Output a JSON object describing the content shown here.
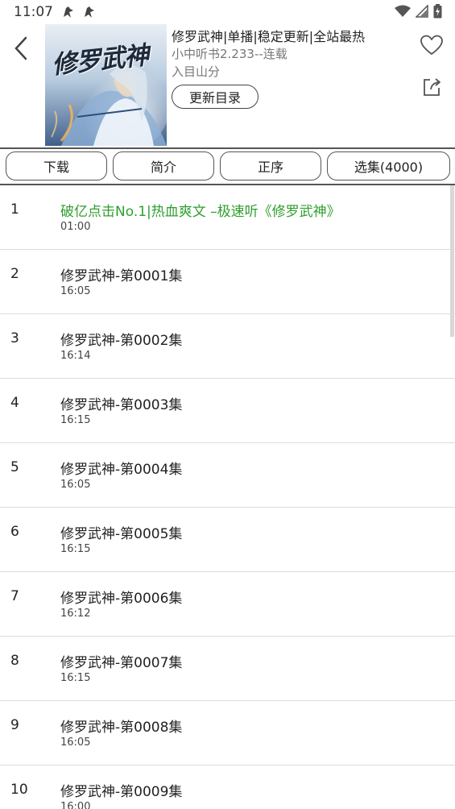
{
  "status_bar": {
    "time": "11:07"
  },
  "header": {
    "title": "修罗武神|单播|稳定更新|全站最热",
    "subtitle": "小中听书2.233--连载",
    "author": "入目山分",
    "update_button": "更新目录",
    "cover_art_text": "修罗武神"
  },
  "tabs": [
    {
      "label": "下载"
    },
    {
      "label": "简介"
    },
    {
      "label": "正序"
    },
    {
      "label": "选集(4000)"
    }
  ],
  "episodes": [
    {
      "num": "1",
      "title": "破亿点击No.1|热血爽文 –极速听《修罗武神》",
      "duration": "01:00",
      "highlight": true
    },
    {
      "num": "2",
      "title": "修罗武神-第0001集",
      "duration": "16:05"
    },
    {
      "num": "3",
      "title": "修罗武神-第0002集",
      "duration": "16:14"
    },
    {
      "num": "4",
      "title": "修罗武神-第0003集",
      "duration": "16:15"
    },
    {
      "num": "5",
      "title": "修罗武神-第0004集",
      "duration": "16:05"
    },
    {
      "num": "6",
      "title": "修罗武神-第0005集",
      "duration": "16:15"
    },
    {
      "num": "7",
      "title": "修罗武神-第0006集",
      "duration": "16:12"
    },
    {
      "num": "8",
      "title": "修罗武神-第0007集",
      "duration": "16:15"
    },
    {
      "num": "9",
      "title": "修罗武神-第0008集",
      "duration": "16:05"
    },
    {
      "num": "10",
      "title": "修罗武神-第0009集",
      "duration": "16:00"
    }
  ],
  "colors": {
    "highlight": "#2f9e2f",
    "border": "#555555"
  },
  "icons": {
    "back": "chevron-left-icon",
    "favorite": "heart-icon",
    "share": "share-icon"
  }
}
